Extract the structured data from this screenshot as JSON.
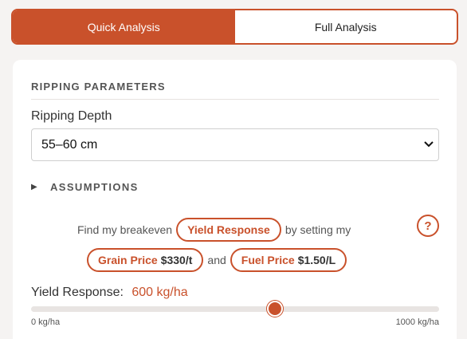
{
  "tabs": [
    {
      "label": "Quick Analysis",
      "active": true
    },
    {
      "label": "Full Analysis",
      "active": false
    }
  ],
  "section": {
    "title": "RIPPING PARAMETERS"
  },
  "ripping_depth": {
    "label": "Ripping Depth",
    "selected": "55–60 cm"
  },
  "assumptions": {
    "label": "ASSUMPTIONS"
  },
  "breakeven": {
    "prefix": "Find my breakeven",
    "target_pill": "Yield Response",
    "middle": "by setting my",
    "grain_label": "Grain Price",
    "grain_value": "$330/t",
    "and": "and",
    "fuel_label": "Fuel Price",
    "fuel_value": "$1.50/L",
    "help": "?"
  },
  "yield_response": {
    "label": "Yield Response:",
    "value_text": "600 kg/ha",
    "value": 600,
    "min": 0,
    "max": 1000,
    "min_label": "0 kg/ha",
    "max_label": "1000 kg/ha"
  },
  "colors": {
    "accent": "#c9512b"
  }
}
